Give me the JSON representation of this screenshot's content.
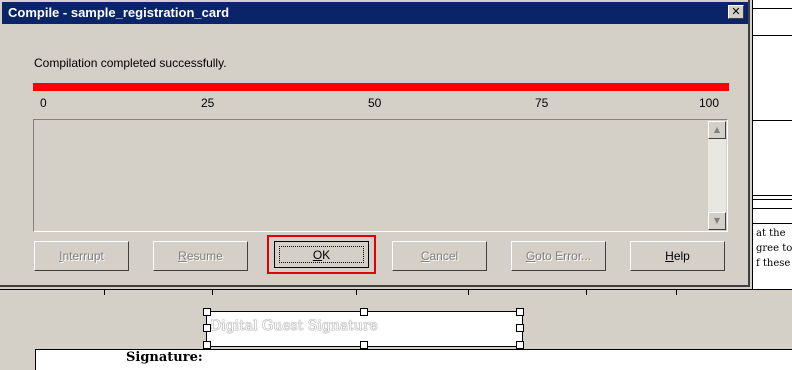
{
  "dialog": {
    "title": "Compile - sample_registration_card",
    "close_glyph": "✕",
    "status_message": "Compilation completed successfully.",
    "progress_percent": 100,
    "progress_color": "#ff0000",
    "ticks": [
      "0",
      "25",
      "50",
      "75",
      "100"
    ],
    "buttons": {
      "interrupt": {
        "pre": "",
        "u": "I",
        "post": "nterrupt"
      },
      "resume": {
        "pre": "",
        "u": "R",
        "post": "esume"
      },
      "ok": {
        "pre": "",
        "u": "O",
        "post": "K"
      },
      "cancel": {
        "pre": "",
        "u": "C",
        "post": "ancel"
      },
      "goto_error": {
        "pre": "",
        "u": "G",
        "post": "oto Error..."
      },
      "help": {
        "pre": "",
        "u": "H",
        "post": "elp"
      }
    }
  },
  "document": {
    "side_text": [
      "at the",
      "gree to",
      "f these"
    ],
    "signature_field_label": "Digital Guest Signature",
    "signature_table_label": "Signature:"
  },
  "colors": {
    "title_bar": "#0a246a",
    "highlight": "#e00000"
  }
}
